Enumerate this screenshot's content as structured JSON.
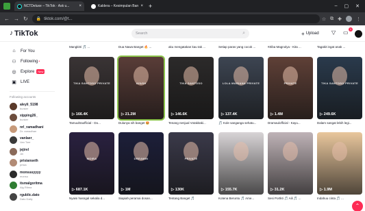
{
  "browser": {
    "tabs": [
      {
        "title": "NCTDeluxe – TikTok · Ask u...",
        "active": true
      },
      {
        "title": "Kaldera – Kesimpulan Banget · K...",
        "active": false
      }
    ],
    "url": "tiktok.com/@t...",
    "new_tab": "+"
  },
  "header": {
    "logo": "TikTok",
    "search_placeholder": "Search",
    "upload_label": "Upload",
    "inbox_count": "1"
  },
  "sidebar": {
    "nav": [
      {
        "label": "For You",
        "icon": "home-icon"
      },
      {
        "label": "Following",
        "icon": "following-icon"
      },
      {
        "label": "Explore",
        "icon": "explore-icon",
        "badge": "New"
      },
      {
        "label": "LIVE",
        "icon": "live-icon"
      }
    ],
    "following_heading": "Following accounts",
    "accounts": [
      {
        "name": "aleyli_5198",
        "sub": "bunker",
        "color": "#5a3a2a"
      },
      {
        "name": "xipping26_",
        "sub": "bunker",
        "color": "#6d4d3d"
      },
      {
        "name": "nrl_ramadhani",
        "sub": "Dr. ramadhan",
        "color": "#c79a7a"
      },
      {
        "name": "vanlaer_",
        "sub": "Van Toer",
        "color": "#3a3a3a"
      },
      {
        "name": "jejirel",
        "sub": "Jei",
        "color": "#8a6a5a"
      },
      {
        "name": "prisianseth",
        "sub": "prisia",
        "color": "#b28b75"
      },
      {
        "name": "monsuuyyyy",
        "sub": "monsu",
        "color": "#2b2b2b"
      },
      {
        "name": "itsmalgoritma",
        "sub": "Alg Ritma",
        "color": "#2f7d32"
      },
      {
        "name": "rgublic.dato",
        "sub": "Dato Daily",
        "color": "#444"
      }
    ]
  },
  "top_captions": [
    "Mangkitri 🎵 ...",
    "Dua Nawa Banget 🔥 ...",
    "aku mengatakan kau tak ...",
    "Setiap paras yang cocok ...",
    "#Ziba Magnolya - Kita ...",
    "Tagakit ingat anak ..."
  ],
  "row1": [
    {
      "watermark": "TIKA SANTOSO PRIVATE",
      "views": "166.4K",
      "caption": "Tamuultraofficial - Do...",
      "bg": "#3a3435"
    },
    {
      "watermark": "AYASH",
      "views": "21.2M",
      "caption": "Dulunya sih banget 🤩",
      "bg": "#5a3d38",
      "selected": true
    },
    {
      "watermark": "TIKA SANTOSO",
      "views": "146.6K",
      "caption": "Tenang nenjual Votakitaki...",
      "bg": "#2c2a2a"
    },
    {
      "watermark": "LOLA MARIANA PRIVATE",
      "views": "137.4K",
      "caption": "🎵 Kole sanganga sehatu...",
      "bg": "#3d4552"
    },
    {
      "watermark": "PRIVATE",
      "views": "1.4M",
      "caption": "Dramaulofficial - Kayu...",
      "bg": "#5f4037"
    },
    {
      "watermark": "TIKA SANTOSO PRIVATE",
      "views": "249.6K",
      "caption": "Dalam sangat lebih legi...",
      "bg": "#2a3a4c"
    }
  ],
  "row2": [
    {
      "watermark": "MOIRA",
      "views": "687.1K",
      "caption": "Nyaisi hasngal sekalia d...",
      "bg": "#2a2140"
    },
    {
      "watermark": "DREAMIN",
      "views": "1M",
      "caption": "Siapiah peramai dosan...",
      "bg": "#1d1f3a"
    },
    {
      "watermark": "PRIVATE",
      "views": "130K",
      "caption": "Tentang Banget 🎵",
      "bg": "#3b3a4a"
    },
    {
      "watermark": "",
      "views": "155.7K",
      "caption": "Kotena Beruntu 🎵 Ame...",
      "bg": "#d8d4d6"
    },
    {
      "watermark": "",
      "views": "31.2K",
      "caption": "Sesi Portkti 🎵 Aili 🎵 ...",
      "bg": "#bfb3b7"
    },
    {
      "watermark": "",
      "views": "1.9M",
      "caption": "Indahuu cinta 🎵 ...",
      "bg": "#e9c79d"
    }
  ],
  "fab_icon": "chevron-up-icon"
}
